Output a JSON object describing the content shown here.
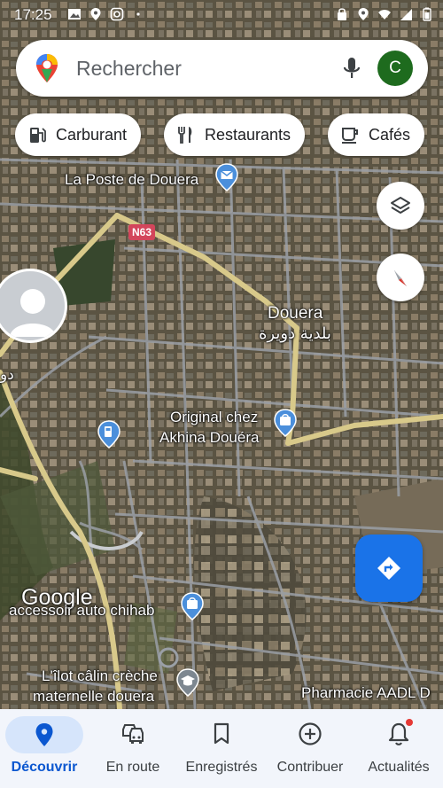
{
  "status_bar": {
    "time": "17:25"
  },
  "search": {
    "placeholder": "Rechercher",
    "account_initial": "C"
  },
  "chips": [
    {
      "label": "Carburant",
      "icon": "gas-station-icon"
    },
    {
      "label": "Restaurants",
      "icon": "fork-knife-icon"
    },
    {
      "label": "Cafés",
      "icon": "coffee-cup-icon"
    }
  ],
  "map": {
    "places": [
      {
        "name": "La Poste de Douera",
        "icon": "mail-pin-icon"
      },
      {
        "name": "N63"
      },
      {
        "name": "Douera"
      },
      {
        "name": "بلدية دويرة"
      },
      {
        "name": "Original chez"
      },
      {
        "name": "Akhina Douéra",
        "icon": "shopping-bag-pin-icon"
      },
      {
        "name": "accessoir auto chihab",
        "icon": "shopping-bag-pin-icon"
      },
      {
        "name": "L'îlot câlin crèche"
      },
      {
        "name": "maternelle douera",
        "icon": "school-pin-icon"
      },
      {
        "name": "Pharmacie AADL D"
      },
      {
        "name": "دو"
      }
    ],
    "logo": "Google"
  },
  "bottom_nav": [
    {
      "label": "Découvrir",
      "icon": "location-pin-icon",
      "active": true
    },
    {
      "label": "En route",
      "icon": "cars-icon",
      "active": false
    },
    {
      "label": "Enregistrés",
      "icon": "bookmark-icon",
      "active": false
    },
    {
      "label": "Contribuer",
      "icon": "add-circle-icon",
      "active": false
    },
    {
      "label": "Actualités",
      "icon": "bell-icon",
      "active": false,
      "badge": true
    }
  ],
  "colors": {
    "accent": "#1a73e8",
    "nav_active": "#0b57d0",
    "avatar_bg": "#1e6b1e",
    "major_road": "#d8c98a"
  }
}
